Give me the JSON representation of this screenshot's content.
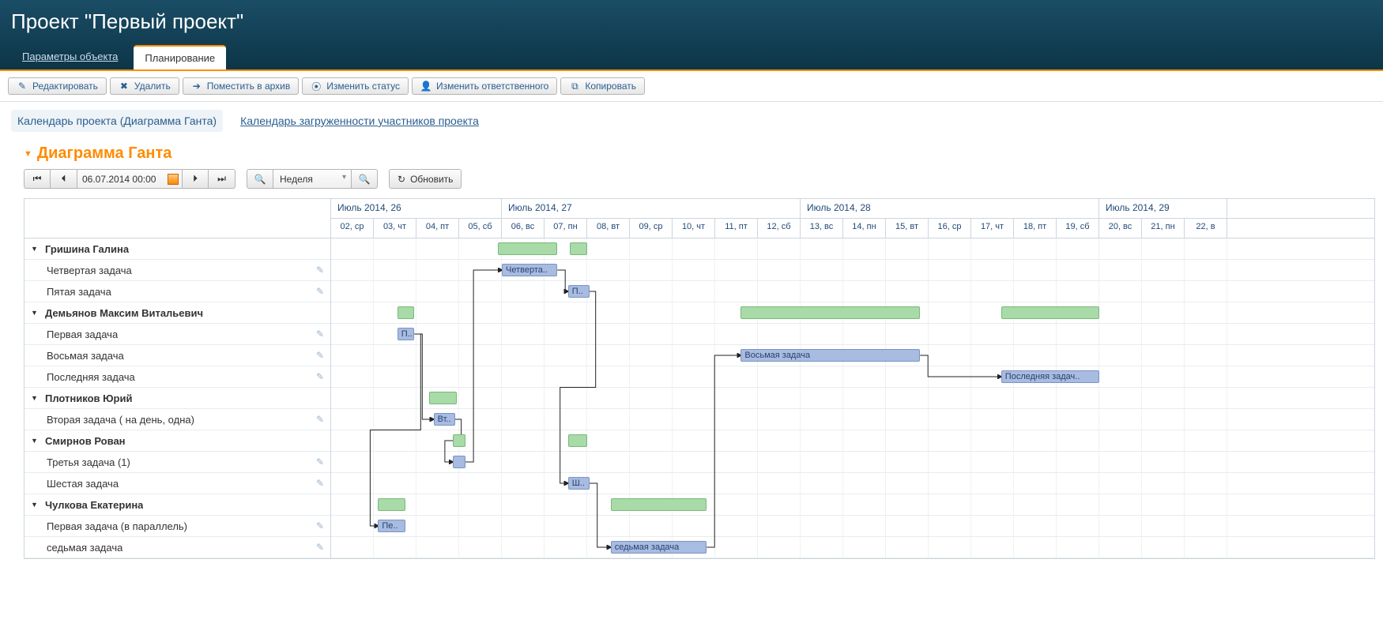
{
  "header": {
    "title": "Проект \"Первый проект\"",
    "tabs": [
      {
        "label": "Параметры объекта",
        "active": false
      },
      {
        "label": "Планирование",
        "active": true
      }
    ]
  },
  "toolbar": {
    "edit": "Редактировать",
    "delete": "Удалить",
    "archive": "Поместить в архив",
    "status": "Изменить статус",
    "responsible": "Изменить ответственного",
    "copy": "Копировать"
  },
  "subtabs": [
    {
      "label": "Календарь проекта (Диаграмма Ганта)",
      "active": true
    },
    {
      "label": "Календарь загруженности участников проекта",
      "active": false
    }
  ],
  "panel": {
    "title": "Диаграмма Ганта",
    "date_value": "06.07.2014 00:00",
    "scale_label": "Неделя",
    "refresh": "Обновить"
  },
  "timeline": {
    "weeks": [
      {
        "label": "Июль 2014, 26",
        "span_days": 4
      },
      {
        "label": "Июль 2014, 27",
        "span_days": 7
      },
      {
        "label": "Июль 2014, 28",
        "span_days": 7
      },
      {
        "label": "Июль 2014, 29",
        "span_days": 3
      }
    ],
    "days": [
      "02, ср",
      "03, чт",
      "04, пт",
      "05, сб",
      "06, вс",
      "07, пн",
      "08, вт",
      "09, ср",
      "10, чт",
      "11, пт",
      "12, сб",
      "13, вс",
      "14, пн",
      "15, вт",
      "16, ср",
      "17, чт",
      "18, пт",
      "19, сб",
      "20, вс",
      "21, пн",
      "22, в"
    ]
  },
  "rows": [
    {
      "type": "group",
      "label": "Гришина Галина",
      "summary_bars": [
        {
          "start": 3.9,
          "end": 5.3
        },
        {
          "start": 5.6,
          "end": 6.0
        }
      ]
    },
    {
      "type": "task",
      "label": "Четвертая задача",
      "bar": {
        "start": 4.0,
        "end": 5.3,
        "text": "Четверта.."
      }
    },
    {
      "type": "task",
      "label": "Пятая задача",
      "bar": {
        "start": 5.55,
        "end": 6.05,
        "text": "П.."
      }
    },
    {
      "type": "group",
      "label": "Демьянов Максим Витальевич",
      "summary_bars": [
        {
          "start": 1.55,
          "end": 1.95
        },
        {
          "start": 9.6,
          "end": 13.8
        },
        {
          "start": 15.7,
          "end": 18.0
        }
      ]
    },
    {
      "type": "task",
      "label": "Первая задача",
      "bar": {
        "start": 1.55,
        "end": 1.95,
        "text": "П.."
      }
    },
    {
      "type": "task",
      "label": "Восьмая задача",
      "bar": {
        "start": 9.6,
        "end": 13.8,
        "text": "Восьмая задача"
      }
    },
    {
      "type": "task",
      "label": "Последняя задача",
      "bar": {
        "start": 15.7,
        "end": 18.0,
        "text": "Последняя задач.."
      }
    },
    {
      "type": "group",
      "label": "Плотников Юрий",
      "summary_bars": [
        {
          "start": 2.3,
          "end": 2.95
        }
      ]
    },
    {
      "type": "task",
      "label": "Вторая задача ( на день, одна)",
      "bar": {
        "start": 2.4,
        "end": 2.9,
        "text": "Вт.."
      }
    },
    {
      "type": "group",
      "label": "Смирнов Рован",
      "summary_bars": [
        {
          "start": 2.85,
          "end": 3.15
        },
        {
          "start": 5.55,
          "end": 6.0
        }
      ]
    },
    {
      "type": "task",
      "label": "Третья задача (1)",
      "bar": {
        "start": 2.85,
        "end": 3.15,
        "text": ""
      }
    },
    {
      "type": "task",
      "label": "Шестая задача",
      "bar": {
        "start": 5.55,
        "end": 6.05,
        "text": "Ш.."
      }
    },
    {
      "type": "group",
      "label": "Чулкова Екатерина",
      "summary_bars": [
        {
          "start": 1.1,
          "end": 1.75
        },
        {
          "start": 6.55,
          "end": 8.8
        }
      ]
    },
    {
      "type": "task",
      "label": "Первая задача (в параллель)",
      "bar": {
        "start": 1.1,
        "end": 1.75,
        "text": "Пе.."
      }
    },
    {
      "type": "task",
      "label": "седьмая задача",
      "bar": {
        "start": 6.55,
        "end": 8.8,
        "text": "седьмая задача"
      }
    }
  ],
  "links": [
    {
      "from_row": 4,
      "from_day": 1.95,
      "to_row": 8,
      "to_day": 2.4
    },
    {
      "from_row": 4,
      "from_day": 1.95,
      "to_row": 13,
      "to_day": 1.1,
      "loopback": true
    },
    {
      "from_row": 8,
      "from_day": 2.9,
      "to_row": 10,
      "to_day": 2.85,
      "loopback": true
    },
    {
      "from_row": 10,
      "from_day": 3.15,
      "to_row": 1,
      "to_day": 4.0
    },
    {
      "from_row": 1,
      "from_day": 5.3,
      "to_row": 2,
      "to_day": 5.55
    },
    {
      "from_row": 2,
      "from_day": 6.05,
      "to_row": 11,
      "to_day": 5.55,
      "loopback": true
    },
    {
      "from_row": 11,
      "from_day": 6.05,
      "to_row": 14,
      "to_day": 6.55
    },
    {
      "from_row": 14,
      "from_day": 8.8,
      "to_row": 5,
      "to_day": 9.6
    },
    {
      "from_row": 5,
      "from_day": 13.8,
      "to_row": 6,
      "to_day": 15.7
    }
  ]
}
